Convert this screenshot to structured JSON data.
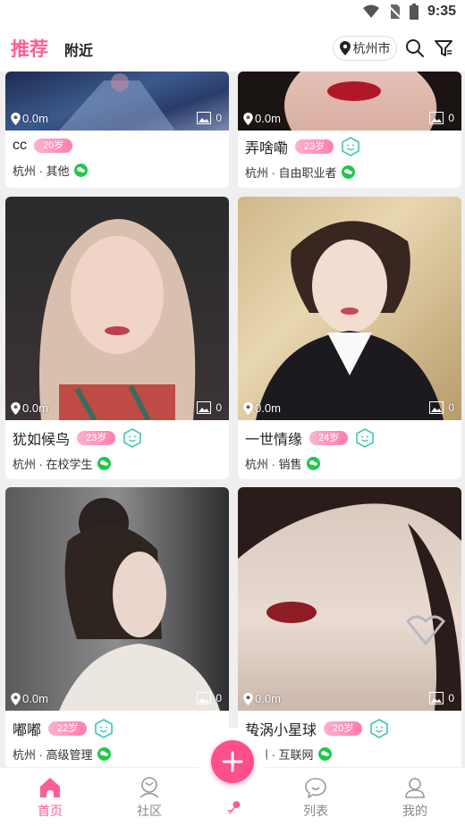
{
  "status": {
    "time": "9:35"
  },
  "header": {
    "tab_recommend": "推荐",
    "tab_nearby": "附近",
    "city": "杭州市"
  },
  "colors": {
    "accent": "#ff5b98",
    "wechat": "#1fc84a",
    "verify": "#3cc8b4"
  },
  "cards": [
    {
      "name": "cc",
      "age": "20岁",
      "city_job": "杭州 · 其他",
      "distance": "0.0m",
      "photos": "0",
      "verified": false
    },
    {
      "name": "弄啥嘞",
      "age": "23岁",
      "city_job": "杭州 · 自由职业者",
      "distance": "0.0m",
      "photos": "0",
      "verified": true
    },
    {
      "name": "犹如候鸟",
      "age": "23岁",
      "city_job": "杭州 · 在校学生",
      "distance": "0.0m",
      "photos": "0",
      "verified": true
    },
    {
      "name": "一世情缘",
      "age": "24岁",
      "city_job": "杭州 · 销售",
      "distance": "0.0m",
      "photos": "0",
      "verified": true
    },
    {
      "name": "嘟嘟",
      "age": "22岁",
      "city_job": "杭州 · 高级管理",
      "distance": "0.0m",
      "photos": "0",
      "verified": true
    },
    {
      "name": "蛰涡小星球",
      "age": "20岁",
      "city_job": "杭州 · 互联网",
      "distance": "0.0m",
      "photos": "0",
      "verified": true
    }
  ],
  "nav": {
    "home": "首页",
    "community": "社区",
    "list": "列表",
    "mine": "我的"
  }
}
